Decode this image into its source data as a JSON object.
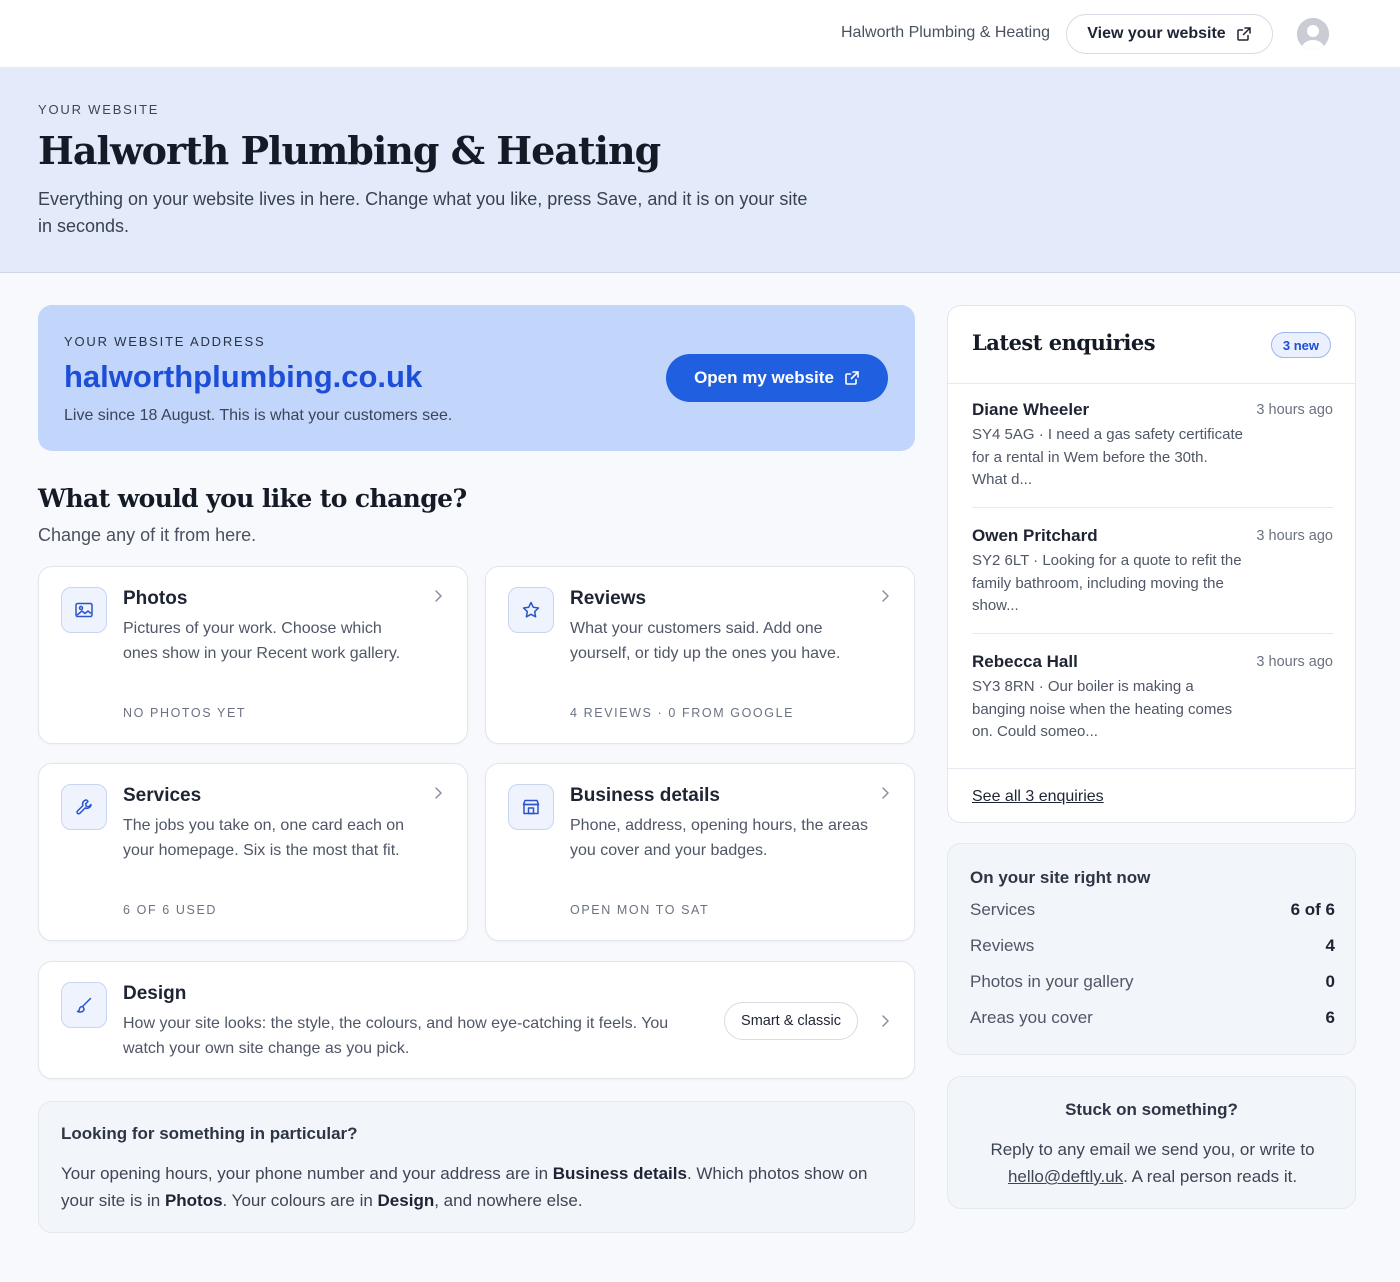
{
  "topbar": {
    "business_name": "Halworth Plumbing & Heating",
    "view_website_label": "View your website"
  },
  "hero": {
    "eyebrow": "YOUR WEBSITE",
    "title": "Halworth Plumbing & Heating",
    "lead": "Everything on your website lives in here. Change what you like, press Save, and it is on your site in seconds."
  },
  "address": {
    "eyebrow": "YOUR WEBSITE ADDRESS",
    "domain": "halworthplumbing.co.uk",
    "since": "Live since 18 August. This is what your customers see.",
    "open_label": "Open my website"
  },
  "change": {
    "title": "What would you like to change?",
    "subtitle": "Change any of it from here."
  },
  "cards": {
    "photos": {
      "title": "Photos",
      "desc": "Pictures of your work. Choose which ones show in your Recent work gallery.",
      "meta": "NO PHOTOS YET",
      "icon": "image-icon"
    },
    "reviews": {
      "title": "Reviews",
      "desc": "What your customers said. Add one yourself, or tidy up the ones you have.",
      "meta": "4 REVIEWS · 0 FROM GOOGLE",
      "icon": "star-icon"
    },
    "services": {
      "title": "Services",
      "desc": "The jobs you take on, one card each on your homepage. Six is the most that fit.",
      "meta": "6 OF 6 USED",
      "icon": "wrench-icon"
    },
    "business": {
      "title": "Business details",
      "desc": "Phone, address, opening hours, the areas you cover and your badges.",
      "meta": "OPEN MON TO SAT",
      "icon": "shop-icon"
    },
    "design": {
      "title": "Design",
      "desc": "How your site looks: the style, the colours, and how eye-catching it feels. You watch your own site change as you pick.",
      "style_pill": "Smart & classic",
      "icon": "brush-icon"
    }
  },
  "help": {
    "question": "Looking for something in particular?",
    "p1": "Your opening hours, your phone number and your address are in ",
    "b1": "Business details",
    "p2": ". Which photos show on your site is in ",
    "b2": "Photos",
    "p3": ". Your colours are in ",
    "b3": "Design",
    "p4": ", and nowhere else."
  },
  "enquiries": {
    "title": "Latest enquiries",
    "badge": "3 new",
    "items": [
      {
        "name": "Diane Wheeler",
        "time": "3 hours ago",
        "message": "SY4 5AG · I need a gas safety certificate for a rental in Wem before the 30th. What d..."
      },
      {
        "name": "Owen Pritchard",
        "time": "3 hours ago",
        "message": "SY2 6LT · Looking for a quote to refit the family bathroom, including moving the show..."
      },
      {
        "name": "Rebecca Hall",
        "time": "3 hours ago",
        "message": "SY3 8RN · Our boiler is making a banging noise when the heating comes on. Could someo..."
      }
    ],
    "see_all": "See all 3 enquiries"
  },
  "stats": {
    "title": "On your site right now",
    "rows": [
      {
        "label": "Services",
        "value": "6 of 6"
      },
      {
        "label": "Reviews",
        "value": "4"
      },
      {
        "label": "Photos in your gallery",
        "value": "0"
      },
      {
        "label": "Areas you cover",
        "value": "6"
      }
    ]
  },
  "stuck": {
    "title": "Stuck on something?",
    "text1": "Reply to any email we send you, or write to ",
    "email": "hello@deftly.uk",
    "text2": ". A real person reads it."
  },
  "colors": {
    "accent": "#1f5fe0",
    "hero_bg": "#e3ebfb",
    "address_bg": "#c2d5fa"
  }
}
